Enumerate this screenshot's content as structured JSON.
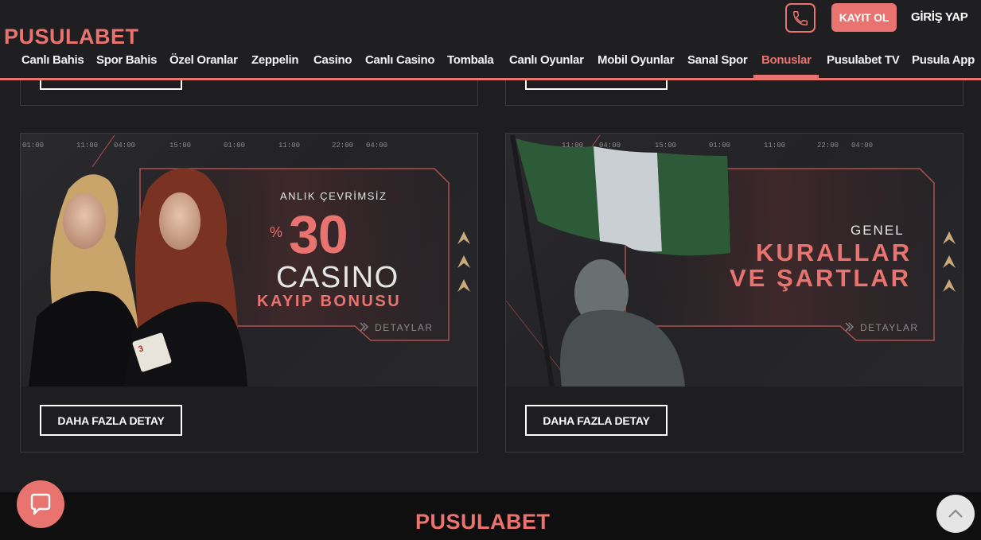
{
  "header": {
    "logo_text": "PUSULABET",
    "register_label": "KAYIT OL",
    "login_label": "GİRİŞ YAP",
    "accent_color": "#e8736f"
  },
  "nav": {
    "items": [
      {
        "label": "Canlı Bahis",
        "active": false
      },
      {
        "label": "Spor Bahis",
        "active": false
      },
      {
        "label": "Özel Oranlar",
        "active": false
      },
      {
        "label": "Zeppelin",
        "active": false
      },
      {
        "label": "Casino",
        "active": false
      },
      {
        "label": "Canlı Casino",
        "active": false
      },
      {
        "label": "Tombala",
        "active": false
      },
      {
        "label": "Canlı Oyunlar",
        "active": false
      },
      {
        "label": "Mobil Oyunlar",
        "active": false
      },
      {
        "label": "Sanal Spor",
        "active": false
      },
      {
        "label": "Bonuslar",
        "active": true
      },
      {
        "label": "Pusulabet TV",
        "active": false
      },
      {
        "label": "Pusula App",
        "active": false
      }
    ]
  },
  "banner_times": [
    "01:00",
    "11:00",
    "04:00",
    "15:00",
    "01:00",
    "11:00",
    "22:00",
    "04:00"
  ],
  "cards": [
    {
      "sub": "ANLIK ÇEVRİMSİZ",
      "percent": "%",
      "number": "30",
      "title": "CASINO",
      "tagline": "KAYIP BONUSU",
      "detail": "DETAYLAR",
      "button": "DAHA FAZLA DETAY"
    },
    {
      "sub": "GENEL",
      "line1": "KURALLAR",
      "line2": "VE ŞARTLAR",
      "detail": "DETAYLAR",
      "button": "DAHA FAZLA DETAY"
    }
  ],
  "footer": {
    "logo_text": "PUSULABET"
  }
}
